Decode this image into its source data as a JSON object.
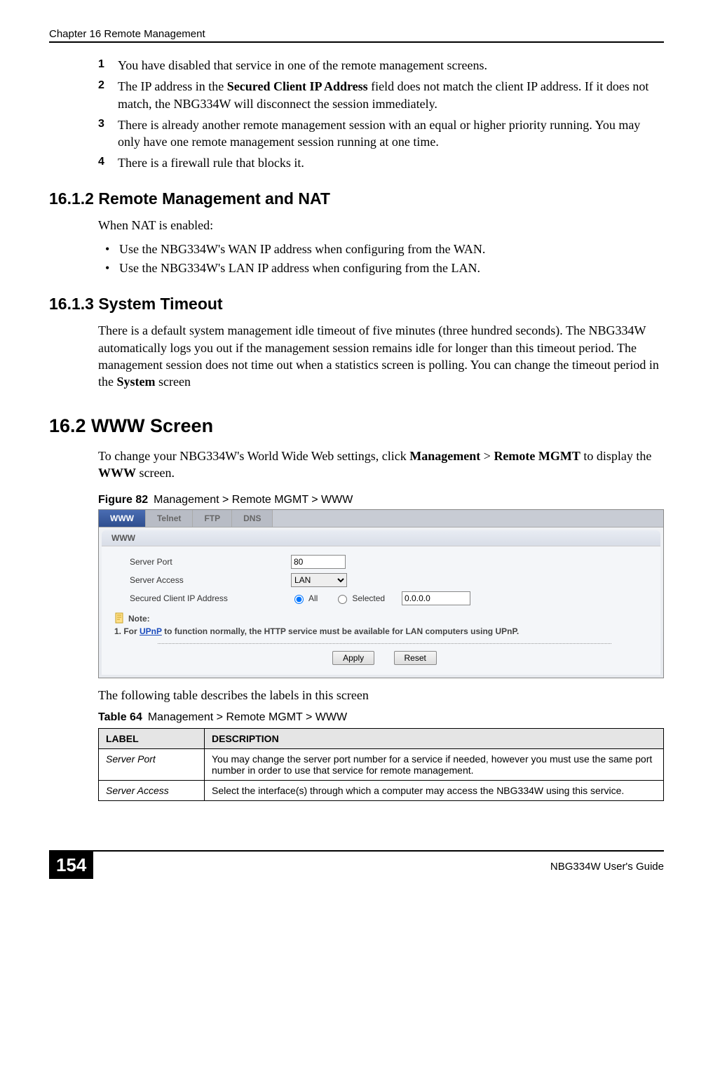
{
  "header": {
    "left": "Chapter 16 Remote Management"
  },
  "list1": {
    "i1": {
      "num": "1",
      "text_a": "You have disabled that service in one of the remote management screens."
    },
    "i2": {
      "num": "2",
      "text_a": "The IP address in the ",
      "bold": "Secured Client IP Address",
      "text_b": " field does not match the client IP address. If it does not match, the NBG334W will disconnect the session immediately."
    },
    "i3": {
      "num": "3",
      "text_a": "There is already another remote management session with an equal or higher priority running. You may only have one remote management session running at one time."
    },
    "i4": {
      "num": "4",
      "text_a": "There is a firewall rule that blocks it."
    }
  },
  "sec_16_1_2": {
    "heading": "16.1.2  Remote Management and NAT",
    "intro": "When NAT is enabled:",
    "b1": "Use the NBG334W's WAN IP address when configuring from the WAN.",
    "b2": "Use the NBG334W's LAN IP address when configuring from the LAN."
  },
  "sec_16_1_3": {
    "heading": "16.1.3   System Timeout",
    "p1_a": "There is a default system management idle timeout of five minutes (three hundred seconds). The NBG334W automatically logs you out if the management session remains idle for longer than this timeout period. The management session does not time out when a statistics screen is polling. You can change the timeout period in the ",
    "p1_bold": "System",
    "p1_b": " screen"
  },
  "sec_16_2": {
    "heading": "16.2  WWW Screen",
    "p1_a": "To change your NBG334W's World Wide Web settings, click ",
    "b1": "Management",
    "gt1": " > ",
    "b2": "Remote MGMT",
    "mid": " to display the ",
    "b3": "WWW",
    "end": " screen."
  },
  "figure": {
    "caption_label": "Figure 82",
    "caption_title": "Management > Remote MGMT > WWW",
    "tabs": {
      "t1": "WWW",
      "t2": "Telnet",
      "t3": "FTP",
      "t4": "DNS"
    },
    "panel_title": "WWW",
    "row1_label": "Server Port",
    "row1_value": "80",
    "row2_label": "Server Access",
    "row2_value": "LAN",
    "row3_label": "Secured Client IP Address",
    "row3_opt_all": "All",
    "row3_opt_sel": "Selected",
    "row3_ip": "0.0.0.0",
    "note_label": "Note:",
    "note_prefix": "1. For ",
    "note_link": "UPnP",
    "note_suffix": " to function normally, the HTTP service must be available for LAN computers using UPnP.",
    "btn_apply": "Apply",
    "btn_reset": "Reset"
  },
  "after_figure": "The following table describes the labels in this screen",
  "table": {
    "caption_label": "Table 64",
    "caption_title": "Management > Remote MGMT > WWW",
    "h1": "LABEL",
    "h2": "DESCRIPTION",
    "r1_label": "Server Port",
    "r1_desc": "You may change the server port number for a service if needed, however you must use the same port number in order to use that service for remote management.",
    "r2_label": "Server Access",
    "r2_desc": "Select the interface(s) through which a computer may access the NBG334W using this service."
  },
  "footer": {
    "page": "154",
    "guide": "NBG334W User's Guide"
  }
}
